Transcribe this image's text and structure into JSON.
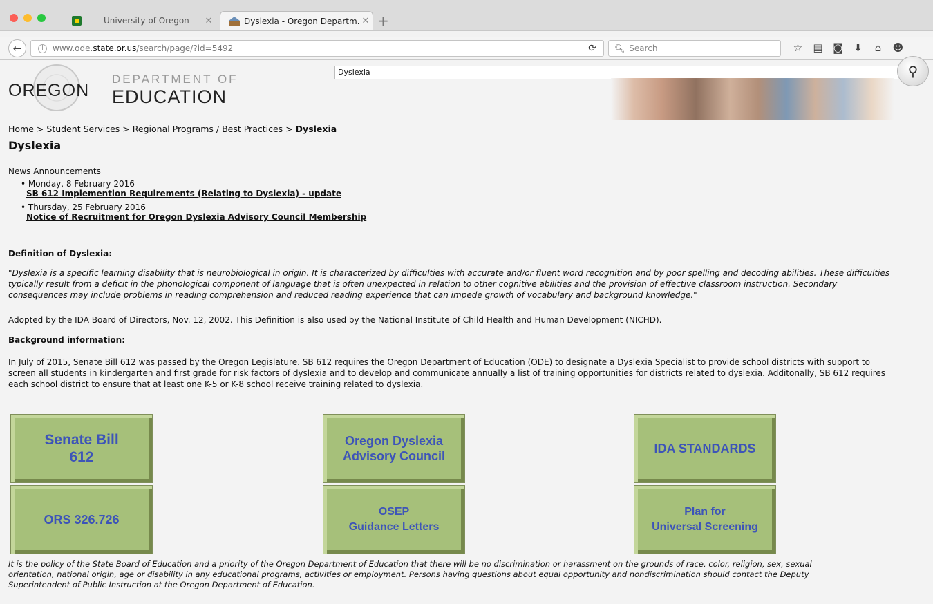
{
  "browser": {
    "tabs": [
      {
        "label": "University of Oregon",
        "active": false
      },
      {
        "label": "Dyslexia - Oregon Departm…",
        "active": true
      }
    ],
    "url_prefix": "www.ode.",
    "url_domain": "state.or.us",
    "url_path": "/search/page/?id=5492",
    "search_placeholder": "Search",
    "colors": {
      "close": "#fc5f57",
      "minimize": "#fdbc2e",
      "maximize": "#28c840"
    }
  },
  "header": {
    "logo_oregon": "OREGON",
    "logo_department": "DEPARTMENT OF",
    "logo_education": "EDUCATION",
    "site_search_value": "Dyslexia"
  },
  "breadcrumb": {
    "items": [
      "Home",
      "Student Services",
      "Regional Programs / Best Practices"
    ],
    "current": "Dyslexia",
    "separator": ">"
  },
  "page_title": "Dyslexia",
  "news": {
    "heading": "News Announcements",
    "items": [
      {
        "date": "Monday, 8 February 2016",
        "title": "SB 612 Implemention Requirements (Relating to Dyslexia) - update"
      },
      {
        "date": "Thursday, 25 February 2016",
        "title": "Notice of Recruitment for Oregon Dyslexia Advisory Council Membership"
      }
    ]
  },
  "definition": {
    "heading": "Definition of Dyslexia:",
    "lines": [
      "\"Dyslexia is a specific learning disability that is neurobiological in origin. It is characterized by difficulties with accurate and/or fluent word recognition and by poor spelling and decoding abilities. These difficulties",
      "typically result from a deficit in the phonological component of language that is often unexpected in relation to other cognitive abilities and the provision of effective classroom instruction. Secondary",
      "consequences may include problems in reading comprehension and reduced reading experience that can impede growth of vocabulary and background knowledge.\""
    ],
    "adopted": "Adopted by the IDA Board of Directors, Nov. 12, 2002. This Definition is also used by the National Institute of Child Health and Human Development (NICHD)."
  },
  "background": {
    "heading": "Background information:",
    "lines": [
      "In July of 2015, Senate Bill 612 was passed by the Oregon Legislature. SB 612 requires the Oregon Department of Education (ODE) to designate a Dyslexia Specialist to provide school districts with support to",
      "screen all students in kindergarten and first grade for risk factors of dyslexia and to develop and communicate annually a list of training opportunities for districts related to dyslexia. Additonally, SB 612 requires",
      "each school district to ensure that at least one K-5 or K-8 school receive training related to dyslexia."
    ]
  },
  "tiles": {
    "senate_bill": [
      "Senate Bill",
      "612"
    ],
    "advisory_council": [
      "Oregon Dyslexia",
      "Advisory Council"
    ],
    "ida_standards": [
      "IDA STANDARDS"
    ],
    "ors": [
      "ORS 326.726"
    ],
    "osep": [
      "OSEP",
      "Guidance Letters"
    ],
    "screening": [
      "Plan for",
      "Universal Screening"
    ]
  },
  "footer": {
    "lines": [
      "It is the policy of the State Board of Education and a priority of the Oregon Department of Education that there will be no discrimination or harassment on the grounds of race, color, religion, sex, sexual",
      "orientation, national origin, age or disability in any educational programs, activities or employment. Persons having questions about equal opportunity and nondiscrimination should contact the Deputy",
      "Superintendent of Public Instruction at the Oregon Department of Education."
    ]
  }
}
